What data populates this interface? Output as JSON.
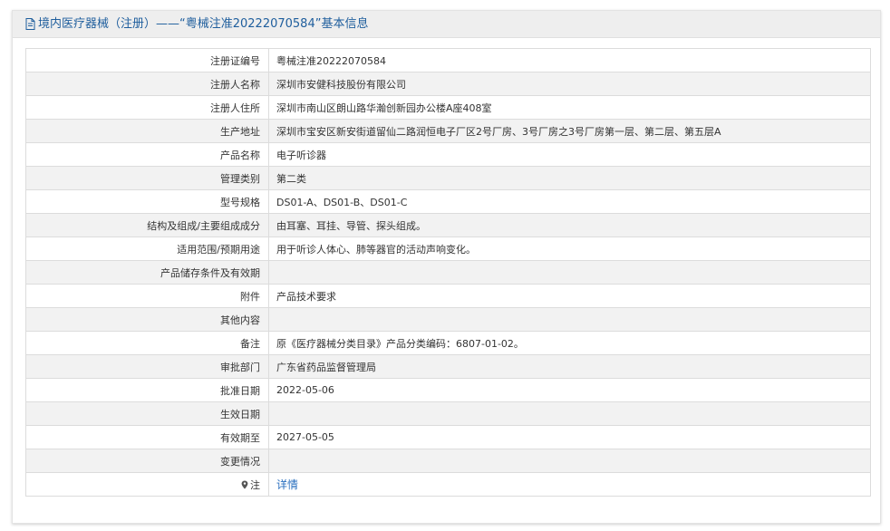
{
  "header": {
    "title": "境内医疗器械（注册）——“粤械注准20222070584”基本信息"
  },
  "rows": [
    {
      "label": "注册证编号",
      "value": "粤械注准20222070584"
    },
    {
      "label": "注册人名称",
      "value": "深圳市安健科技股份有限公司"
    },
    {
      "label": "注册人住所",
      "value": "深圳市南山区朗山路华瀚创新园办公楼A座408室"
    },
    {
      "label": "生产地址",
      "value": "深圳市宝安区新安街道留仙二路润恒电子厂区2号厂房、3号厂房之3号厂房第一层、第二层、第五层A"
    },
    {
      "label": "产品名称",
      "value": "电子听诊器"
    },
    {
      "label": "管理类别",
      "value": "第二类"
    },
    {
      "label": "型号规格",
      "value": "DS01-A、DS01-B、DS01-C"
    },
    {
      "label": "结构及组成/主要组成成分",
      "value": "由耳塞、耳挂、导管、探头组成。"
    },
    {
      "label": "适用范围/预期用途",
      "value": "用于听诊人体心、肺等器官的活动声响变化。"
    },
    {
      "label": "产品储存条件及有效期",
      "value": ""
    },
    {
      "label": "附件",
      "value": "产品技术要求"
    },
    {
      "label": "其他内容",
      "value": ""
    },
    {
      "label": "备注",
      "value": "原《医疗器械分类目录》产品分类编码：6807-01-02。"
    },
    {
      "label": "审批部门",
      "value": "广东省药品监督管理局"
    },
    {
      "label": "批准日期",
      "value": "2022-05-06"
    },
    {
      "label": "生效日期",
      "value": ""
    },
    {
      "label": "有效期至",
      "value": "2027-05-05"
    },
    {
      "label": "变更情况",
      "value": ""
    }
  ],
  "note_row": {
    "label": "注",
    "link": "详情",
    "icon": "map-pin-icon"
  },
  "colors": {
    "header_text": "#1f5e9d",
    "link": "#2a6fbf"
  }
}
